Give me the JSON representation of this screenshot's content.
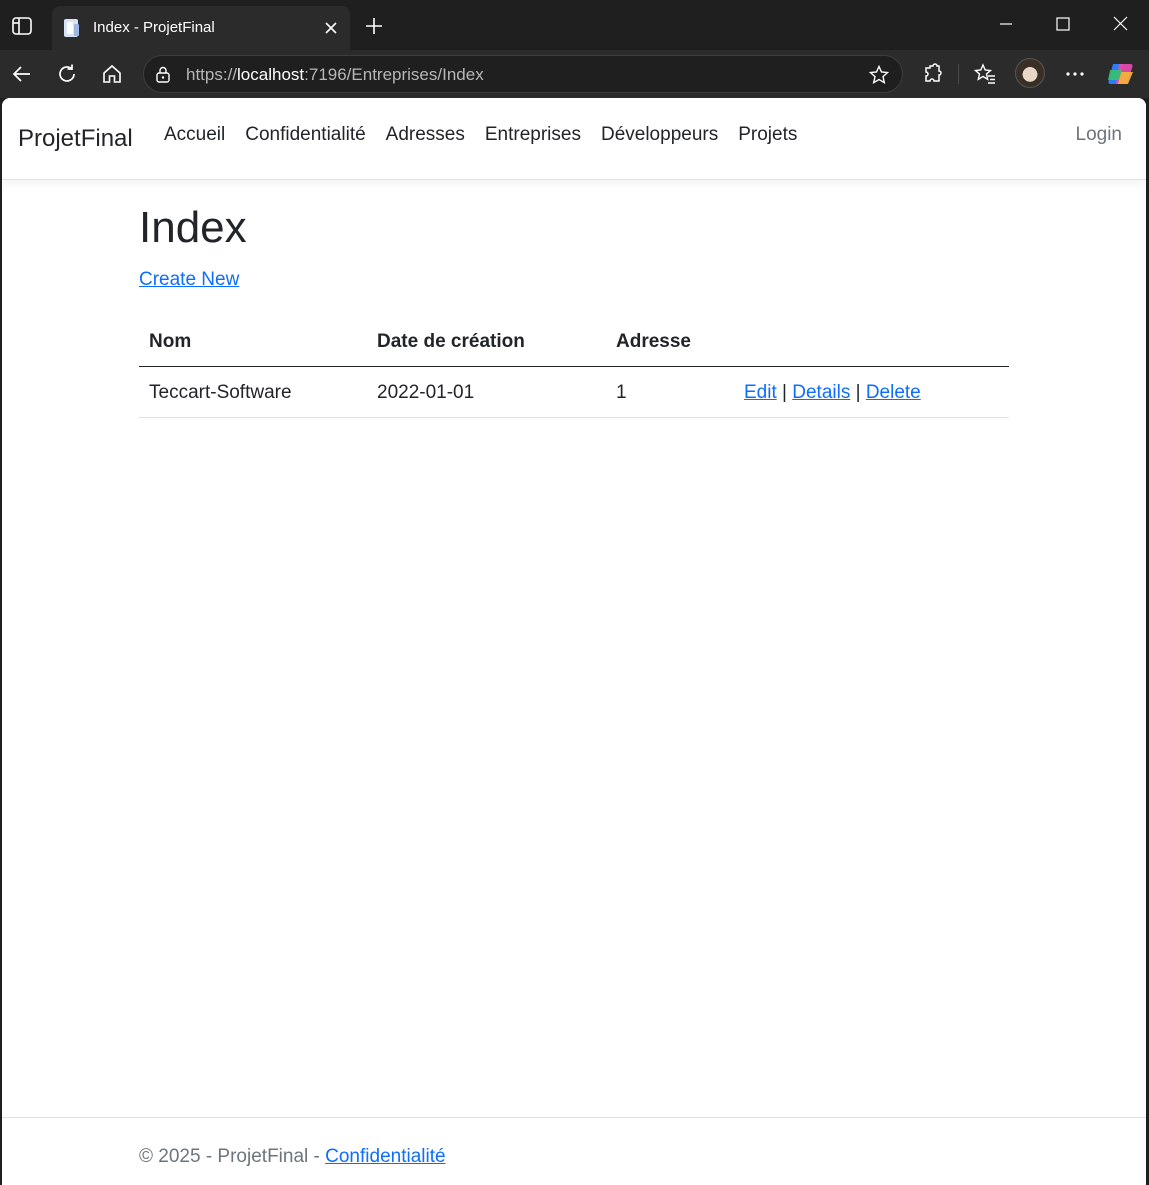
{
  "browser": {
    "tab_title": "Index - ProjetFinal",
    "url_scheme": "https://",
    "url_host": "localhost",
    "url_rest": ":7196/Entreprises/Index",
    "icons": [
      "tab-actions-icon",
      "page-favicon-icon",
      "close-tab-icon",
      "new-tab-icon",
      "minimize-icon",
      "maximize-icon",
      "close-window-icon",
      "back-icon",
      "refresh-icon",
      "home-icon",
      "lock-icon",
      "star-icon",
      "extensions-icon",
      "favorites-icon",
      "profile-avatar",
      "more-icon",
      "copilot-icon"
    ]
  },
  "navbar": {
    "brand": "ProjetFinal",
    "links": [
      "Accueil",
      "Confidentialité",
      "Adresses",
      "Entreprises",
      "Développeurs",
      "Projets"
    ],
    "login": "Login"
  },
  "main": {
    "title": "Index",
    "create_new": "Create New",
    "table": {
      "headers": [
        "Nom",
        "Date de création",
        "Adresse"
      ],
      "rows": [
        {
          "nom": "Teccart-Software",
          "date": "2022-01-01",
          "adresse": "1",
          "edit": "Edit",
          "details": "Details",
          "delete": "Delete",
          "separator": "|"
        }
      ]
    }
  },
  "footer": {
    "text": "© 2025 - ProjetFinal - ",
    "link": "Confidentialité"
  }
}
